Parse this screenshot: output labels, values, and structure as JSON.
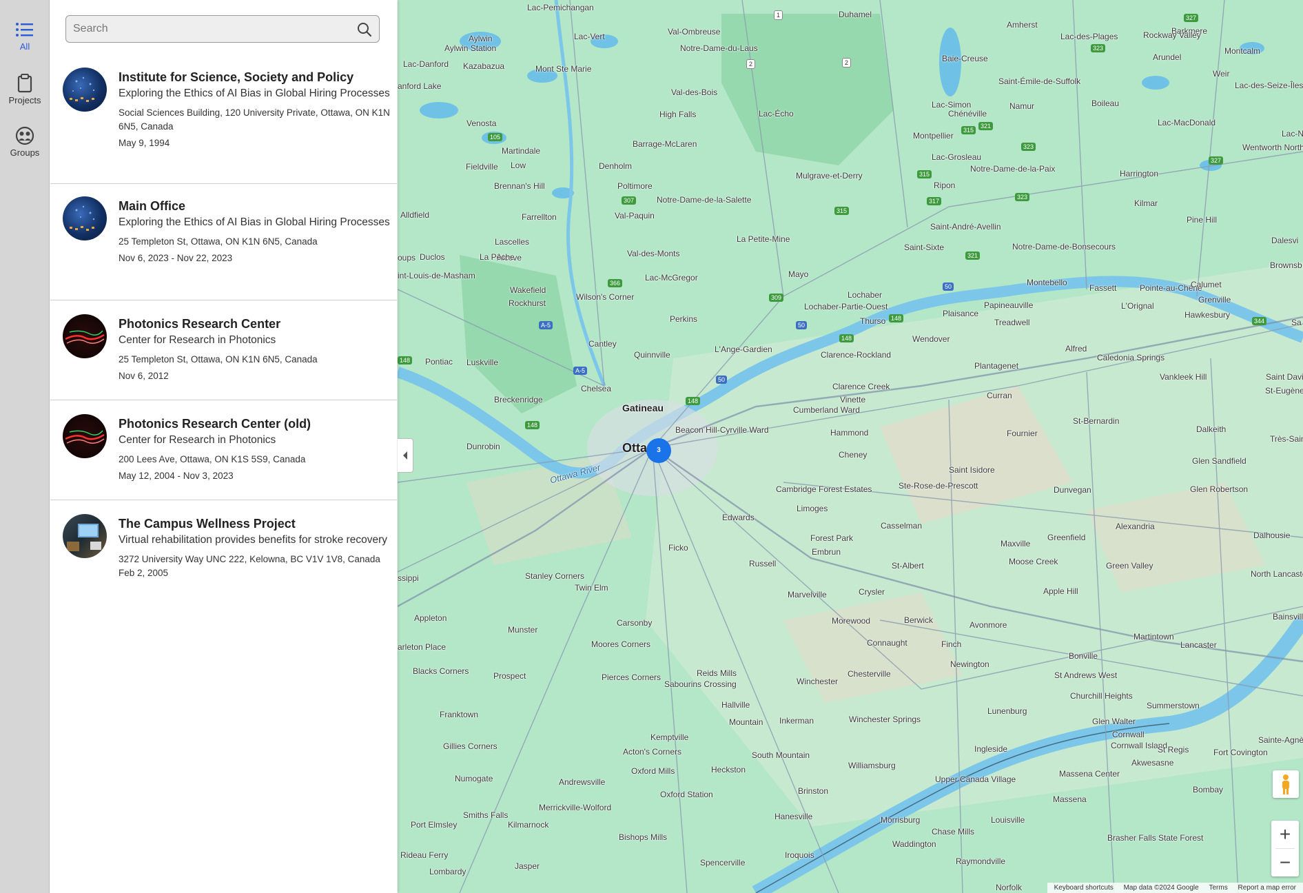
{
  "nav": {
    "items": [
      {
        "label": "All",
        "icon": "list-icon",
        "active": true
      },
      {
        "label": "Projects",
        "icon": "clipboard-icon",
        "active": false
      },
      {
        "label": "Groups",
        "icon": "groups-icon",
        "active": false
      }
    ]
  },
  "search": {
    "placeholder": "Search",
    "value": ""
  },
  "results": [
    {
      "title": "Institute for Science, Society and Policy",
      "subtitle": "Exploring the Ethics of AI Bias in Global Hiring Processes",
      "address": "Social Sciences Building, 120 University Private, Ottawa, ON K1N 6N5, Canada",
      "date": "May 9, 1994"
    },
    {
      "title": "Main Office",
      "subtitle": "Exploring the Ethics of AI Bias in Global Hiring Processes",
      "address": "25 Templeton St, Ottawa, ON K1N 6N5, Canada",
      "date": "Nov 6, 2023 - Nov 22, 2023"
    },
    {
      "title": "Photonics Research Center",
      "subtitle": "Center for Research in Photonics",
      "address": "25 Templeton St, Ottawa, ON K1N 6N5, Canada",
      "date": "Nov 6, 2012"
    },
    {
      "title": "Photonics Research Center (old)",
      "subtitle": "Center for Research in Photonics",
      "address": "200 Lees Ave, Ottawa, ON K1S 5S9, Canada",
      "date": "May 12, 2004 - Nov 3, 2023"
    },
    {
      "title": "The Campus Wellness Project",
      "subtitle": "Virtual rehabilitation provides benefits for stroke recovery",
      "address": "3272 University Way UNC 222, Kelowna, BC V1V 1V8, Canada",
      "date": "Feb 2, 2005"
    }
  ],
  "map": {
    "cluster_count": "3",
    "zoom_in": "+",
    "zoom_out": "−",
    "attribution": {
      "shortcuts": "Keyboard shortcuts",
      "data": "Map data ©2024 Google",
      "terms": "Terms",
      "report": "Report a map error"
    },
    "labels": {
      "ottawa": "Otta",
      "gatineau": "Gatineau",
      "ottawa_river": "Ottawa River",
      "l1": "Lac-Pemichangan",
      "l2": "Duhamel",
      "l3": "Amherst",
      "l4": "Lac-des-Plages",
      "l5": "Barkmere",
      "l6": "Aylwin",
      "l7": "Lac-Vert",
      "l8": "Val-Ombreuse",
      "l9": "Rockway Valley",
      "l10": "Aylwin Station",
      "l11": "Notre-Dame-du-Laus",
      "l12": "Baie-Creuse",
      "l13": "Arundel",
      "l14": "Montcalm",
      "l15": "Lac-Danford",
      "l16": "Kazabazua",
      "l17": "Mont Ste Marie",
      "l18": "Saint-Émile-de-Suffolk",
      "l19": "Weir",
      "l20": "Val-des-Bois",
      "l21": "Lac-Simon",
      "l22": "Boileau",
      "l23": "Venosta",
      "l24": "High Falls",
      "l25": "Lac-Écho",
      "l26": "Namur",
      "l27": "Chénéville",
      "l28": "Lac-MacDonald",
      "l29": "Martindale",
      "l30": "Barrage-McLaren",
      "l31": "Montpellier",
      "l32": "Lac-Grosleau",
      "l33": "Fieldville",
      "l34": "Low",
      "l35": "Denholm",
      "l36": "Mulgrave-et-Derry",
      "l37": "Notre-Dame-de-la-Paix",
      "l38": "Harrington",
      "l39": "Brennan's Hill",
      "l40": "Poltimore",
      "l41": "Ripon",
      "l42": "Notre-Dame-de-la-Salette",
      "l43": "Kilmar",
      "l44": "Alcove",
      "l45": "Farrellton",
      "l46": "Val-Paquin",
      "l47": "Saint-André-Avellin",
      "l48": "Pine Hill",
      "l49": "Lascelles",
      "l50": "La Petite-Mine",
      "l51": "Saint-Sixte",
      "l52": "Notre-Dame-de-Bonsecours",
      "l53": "Duclos",
      "l54": "La Pêche",
      "l55": "Val-des-Monts",
      "l56": "Lac-McGregor",
      "l57": "Mayo",
      "l58": "Wakefield",
      "l59": "Montebello",
      "l60": "Fassett",
      "l61": "Pointe-au-Chêne",
      "l62": "Wilson's Corner",
      "l63": "Lochaber",
      "l64": "Papineauville",
      "l65": "Rockhurst",
      "l66": "Lochaber-Partie-Ouest",
      "l67": "Perkins",
      "l68": "Plaisance",
      "l69": "Thurso",
      "l70": "Treadwell",
      "l71": "Cantley",
      "l72": "L'Ange-Gardien",
      "l73": "Wendover",
      "l74": "Alfred",
      "l75": "Caledonia Springs",
      "l76": "Pontiac",
      "l77": "Luskville",
      "l78": "Quinnville",
      "l79": "Clarence-Rockland",
      "l80": "Plantagenet",
      "l81": "Vankleek Hill",
      "l82": "Chelsea",
      "l83": "Clarence Creek",
      "l84": "Curran",
      "l85": "Breckenridge",
      "l86": "Vinette",
      "l87": "Cumberland Ward",
      "l88": "Beacon Hill-Cyrville Ward",
      "l89": "Hammond",
      "l90": "St-Bernardin",
      "l91": "Dalkeith",
      "l92": "Dunrobin",
      "l93": "Fournier",
      "l94": "Cheney",
      "l95": "Glen Sandfield",
      "l96": "Saint Isidore",
      "l97": "Ste-Rose-de-Prescott",
      "l98": "Cambridge Forest Estates",
      "l99": "Dunvegan",
      "l100": "Limoges",
      "l101": "Edwards",
      "l102": "Casselman",
      "l103": "Glen Robertson",
      "l104": "Forest Park",
      "l105": "Alexandria",
      "l106": "Greenfield",
      "l107": "Maxville",
      "l108": "Embrun",
      "l109": "Ficko",
      "l110": "Russell",
      "l111": "St-Albert",
      "l112": "Moose Creek",
      "l113": "Green Valley",
      "l114": "Stanley Corners",
      "l115": "Twin Elm",
      "l116": "Crysler",
      "l117": "Apple Hill",
      "l118": "Marvelville",
      "l119": "Appleton",
      "l120": "Carsonby",
      "l121": "Morewood",
      "l122": "Berwick",
      "l123": "Avonmore",
      "l124": "Munster",
      "l125": "Martintown",
      "l126": "Connaught",
      "l127": "Finch",
      "l128": "Moores Corners",
      "l129": "Bonville",
      "l130": "Lancaster",
      "l131": "Blacks Corners",
      "l132": "Prospect",
      "l133": "Reids Mills",
      "l134": "Chesterville",
      "l135": "Newington",
      "l136": "St Andrews West",
      "l137": "Winchester",
      "l138": "Pierces Corners",
      "l139": "Sabourins Crossing",
      "l140": "Churchill Heights",
      "l141": "Summerstown",
      "l142": "Hallville",
      "l143": "Franktown",
      "l144": "Mountain",
      "l145": "Inkerman",
      "l146": "Winchester Springs",
      "l147": "Lunenburg",
      "l148": "Glen Walter",
      "l149": "Kemptville",
      "l150": "Cornwall",
      "l151": "Gillies Corners",
      "l152": "Acton's Corners",
      "l153": "South Mountain",
      "l154": "Ingleside",
      "l155": "Cornwall Island",
      "l156": "St Regis",
      "l157": "Fort Covington",
      "l158": "Oxford Mills",
      "l159": "Heckston",
      "l160": "Williamsburg",
      "l161": "Akwesasne",
      "l162": "Numogate",
      "l163": "Andrewsville",
      "l164": "Upper Canada Village",
      "l165": "Massena Center",
      "l166": "Bombay",
      "l167": "Oxford Station",
      "l168": "Brinston",
      "l169": "Massena",
      "l170": "Merrickville-Wolford",
      "l171": "Smiths Falls",
      "l172": "Hanesville",
      "l173": "Morrisburg",
      "l174": "Louisville",
      "l175": "Kilmarnock",
      "l176": "Port Elmsley",
      "l177": "Bishops Mills",
      "l178": "Waddington",
      "l179": "Chase Mills",
      "l180": "Brasher Falls State Forest",
      "l181": "Rideau Ferry",
      "l182": "Spencerville",
      "l183": "Iroquois",
      "l184": "Raymondville",
      "l185": "Lombardy",
      "l186": "Jasper",
      "l187": "Norfolk",
      "l188": "Calumet",
      "l189": "Grenville",
      "l190": "L'Orignal",
      "l191": "Hawkesbury",
      "l192": "Saint Davids",
      "l193": "St-Eugène",
      "l194": "Très-Saint-",
      "l195": "North Lancaster",
      "l196": "Dalhousie",
      "l197": "Bainsville",
      "l198": "Sainte-Agnès-",
      "l199": "Lac-des-Seize-Îles",
      "l200": "Lac-N",
      "l201": "Wentworth North",
      "l202": "Dalesvi",
      "l203": "Brownsb",
      "l204": "Sa",
      "l205": "anford Lake",
      "l206": "Alldfield",
      "l207": "oups",
      "l208": "int-Louis-de-Masham",
      "l209": "ssippi",
      "l210": "arleton Place"
    }
  }
}
